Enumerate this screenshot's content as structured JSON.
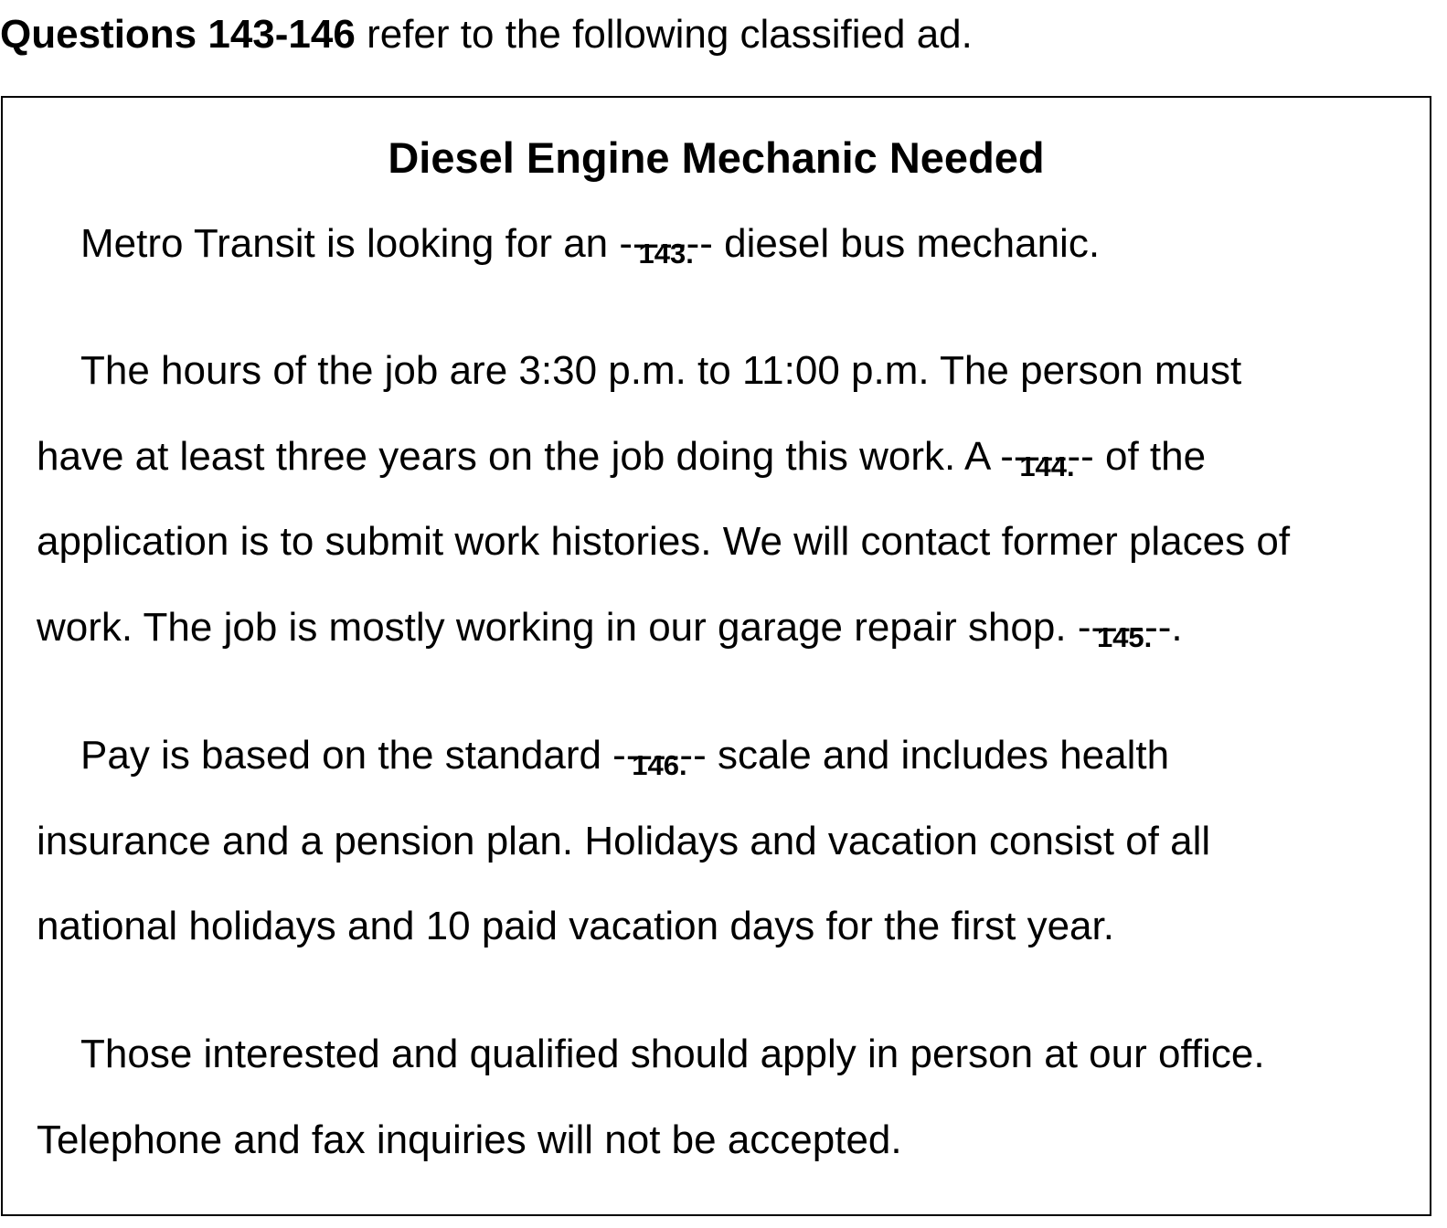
{
  "intro": {
    "bold": "Questions 143-146",
    "rest": " refer to the following classified ad."
  },
  "ad": {
    "title": "Diesel Engine Mechanic Needed",
    "blank": "-------",
    "p1": {
      "before": "Metro Transit is looking for an ",
      "num": "143.",
      "after": " diesel bus mechanic."
    },
    "p2": {
      "line1": "The hours of the job are 3:30 p.m. to 11:00 p.m.  The person must",
      "line2_before": "have at least three years on the job doing this work.  A ",
      "num1": "144.",
      "line2_after": " of the",
      "line3": "application is to submit work histories.  We will contact former places of",
      "line4_before": "work.  The job is mostly working in our garage repair shop.  ",
      "num2": "145.",
      "line4_after": "."
    },
    "p3": {
      "line1_before": "Pay is based on the standard ",
      "num": "146.",
      "line1_after": " scale and includes health",
      "line2": "insurance and a pension plan.  Holidays and vacation consist of all",
      "line3": "national holidays and 10 paid vacation days for the first year."
    },
    "p4": {
      "line1": "Those interested and qualified should apply in person at our office.",
      "line2": "Telephone and fax inquiries will not be accepted."
    }
  }
}
